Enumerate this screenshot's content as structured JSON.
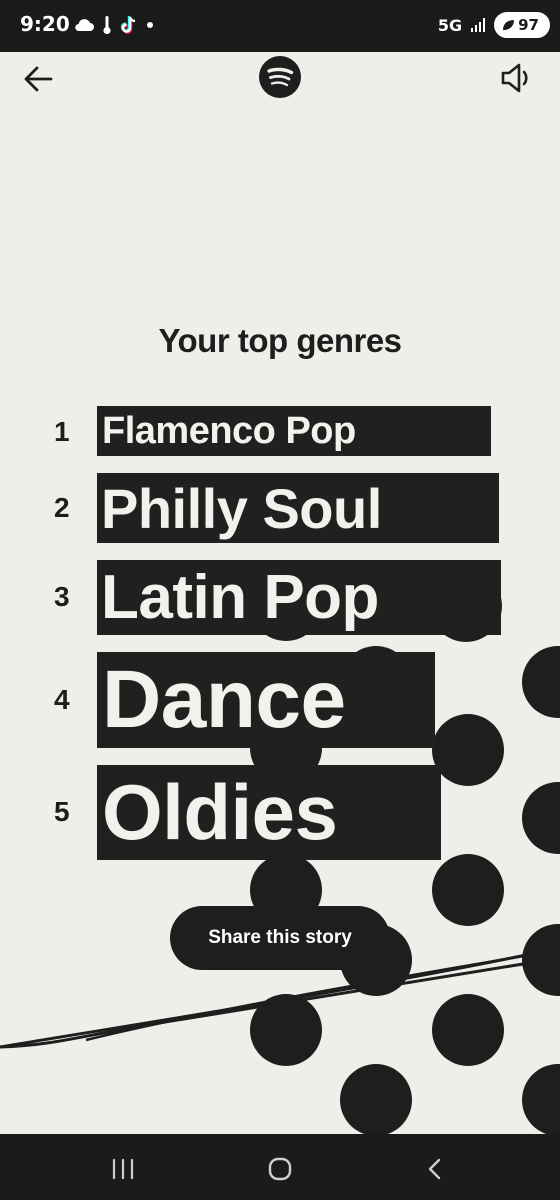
{
  "status_bar": {
    "time": "9:20",
    "network": "5G",
    "battery": "97",
    "icons": [
      "cloud-icon",
      "thermometer-icon",
      "tiktok-icon",
      "dot-icon",
      "signal-icon",
      "battery-saver-icon"
    ]
  },
  "header": {
    "back_icon": "arrow-left-icon",
    "logo_icon": "spotify-logo-icon",
    "sound_icon": "speaker-muted-icon"
  },
  "story": {
    "title": "Your top genres",
    "genres": [
      {
        "rank": "1",
        "name": "Flamenco Pop"
      },
      {
        "rank": "2",
        "name": "Philly Soul"
      },
      {
        "rank": "3",
        "name": "Latin Pop"
      },
      {
        "rank": "4",
        "name": "Dance"
      },
      {
        "rank": "5",
        "name": "Oldies"
      }
    ],
    "share_label": "Share this story"
  },
  "nav_bar": {
    "recents_icon": "recents-icon",
    "home_icon": "home-icon",
    "back_icon": "back-chevron-icon"
  },
  "colors": {
    "background": "#EFEFEA",
    "ink": "#1E1E1E",
    "genre_text": "#F2F2EC",
    "system_bar": "#1B1B1B"
  }
}
